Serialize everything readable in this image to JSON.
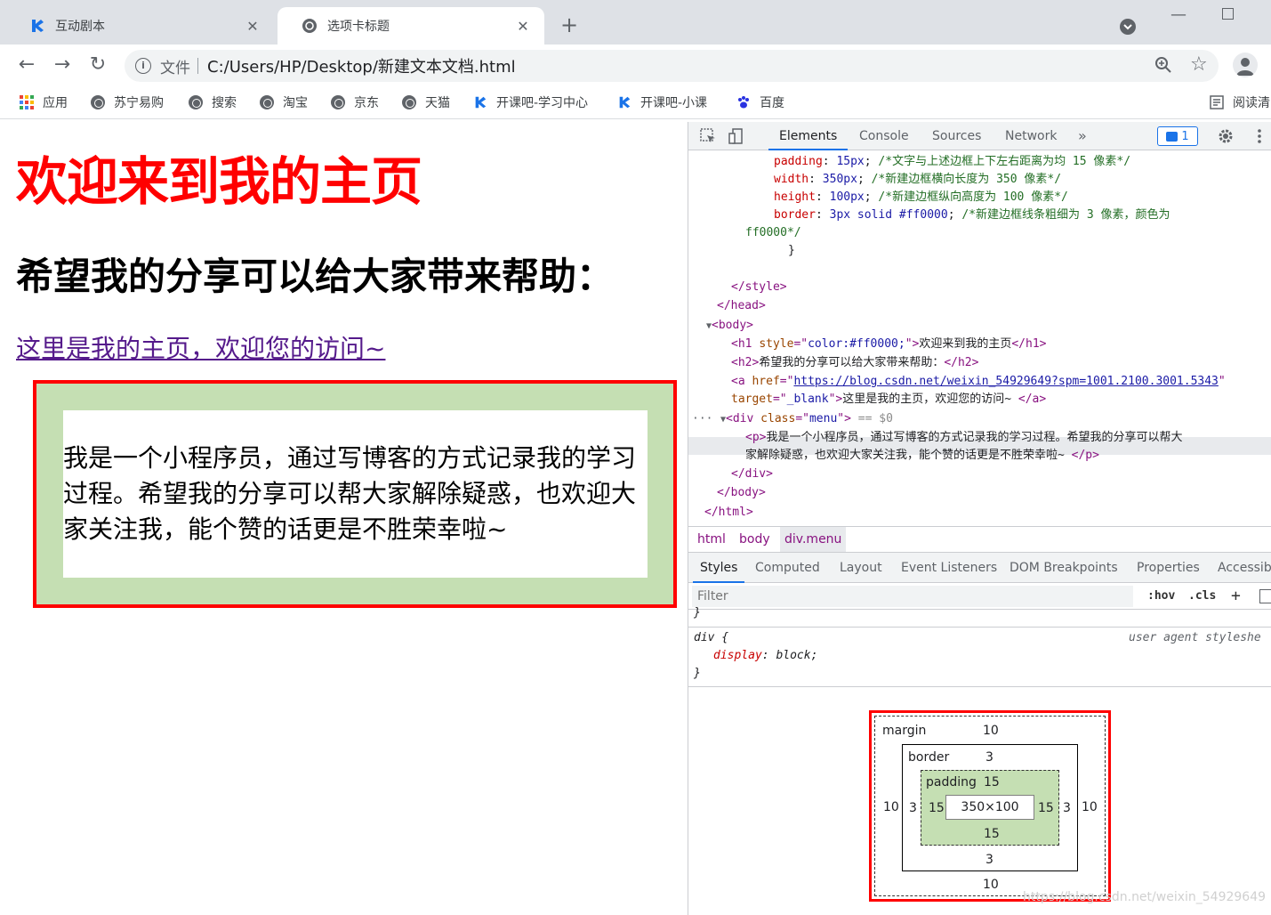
{
  "tabs": [
    {
      "title": "互动剧本"
    },
    {
      "title": "选项卡标题"
    }
  ],
  "omnibox": {
    "scheme": "文件",
    "url": "C:/Users/HP/Desktop/新建文本文档.html"
  },
  "bookmarks": [
    "应用",
    "苏宁易购",
    "搜索",
    "淘宝",
    "京东",
    "天猫",
    "开课吧-学习中心",
    "开课吧-小课",
    "百度",
    "阅读清"
  ],
  "page": {
    "h1": "欢迎来到我的主页",
    "h2": "希望我的分享可以给大家带来帮助：",
    "link": "这里是我的主页，欢迎您的访问~",
    "paragraph": "我是一个小程序员，通过写博客的方式记录我的学习过程。希望我的分享可以帮大家解除疑惑，也欢迎大家关注我，能个赞的话更是不胜荣幸啦~",
    "colors": {
      "heading": "#ff0000",
      "menu_bg": "#c5dfb3",
      "border": "#ff0000"
    }
  },
  "devtools": {
    "tabs": [
      "Elements",
      "Console",
      "Sources",
      "Network"
    ],
    "badge_count": "1",
    "code": {
      "l1": {
        "prop": "padding",
        "val": "15px",
        "comment": "/*文字与上述边框上下左右距离为均 15 像素*/"
      },
      "l2": {
        "prop": "width",
        "val": "350px",
        "comment": "/*新建边框横向长度为 350 像素*/"
      },
      "l3": {
        "prop": "height",
        "val": "100px",
        "comment": "/*新建边框纵向高度为 100 像素*/"
      },
      "l4": {
        "prop": "border",
        "val": "3px solid #ff0000",
        "comment": "/*新建边框线条粗细为 3 像素，颜色为"
      },
      "l5": "ff0000*/",
      "l6": "}",
      "style_close": "</style>",
      "head_close": "</head>",
      "body_open": "<body>",
      "h1_attr": "style",
      "h1_val": "color:#ff0000;",
      "h1_text": "欢迎来到我的主页",
      "h2_text": "希望我的分享可以给大家带来帮助：",
      "a_href": "https://blog.csdn.net/weixin_54929649?spm=1001.2100.3001.5343",
      "a_target": "_blank",
      "a_text": "这里是我的主页，欢迎您的访问~ ",
      "div_class": "menu",
      "div_eq": " == $0",
      "p_text1": "我是一个小程序员，通过写博客的方式记录我的学习过程。希望我的分享可以帮大",
      "p_text2": "家解除疑惑，也欢迎大家关注我，能个赞的话更是不胜荣幸啦~ ",
      "div_close": "</div>",
      "body_close": "</body>",
      "html_close": "</html>"
    },
    "breadcrumbs": [
      "html",
      "body",
      "div.menu"
    ],
    "subtabs": [
      "Styles",
      "Computed",
      "Layout",
      "Event Listeners",
      "DOM Breakpoints",
      "Properties",
      "Accessibi"
    ],
    "filter_placeholder": "Filter",
    "hov": ":hov",
    "cls": ".cls",
    "rules": {
      "prev_brace": "}",
      "selector": "div {",
      "source": "user agent styleshe",
      "prop": "display",
      "val": "block;",
      "close": "}"
    },
    "box_model": {
      "margin_label": "margin",
      "margin": "10",
      "border_label": "border",
      "border": "3",
      "padding_label": "padding",
      "padding": "15",
      "content": "350×100"
    }
  },
  "watermark": "https://blog.csdn.net/weixin_54929649"
}
